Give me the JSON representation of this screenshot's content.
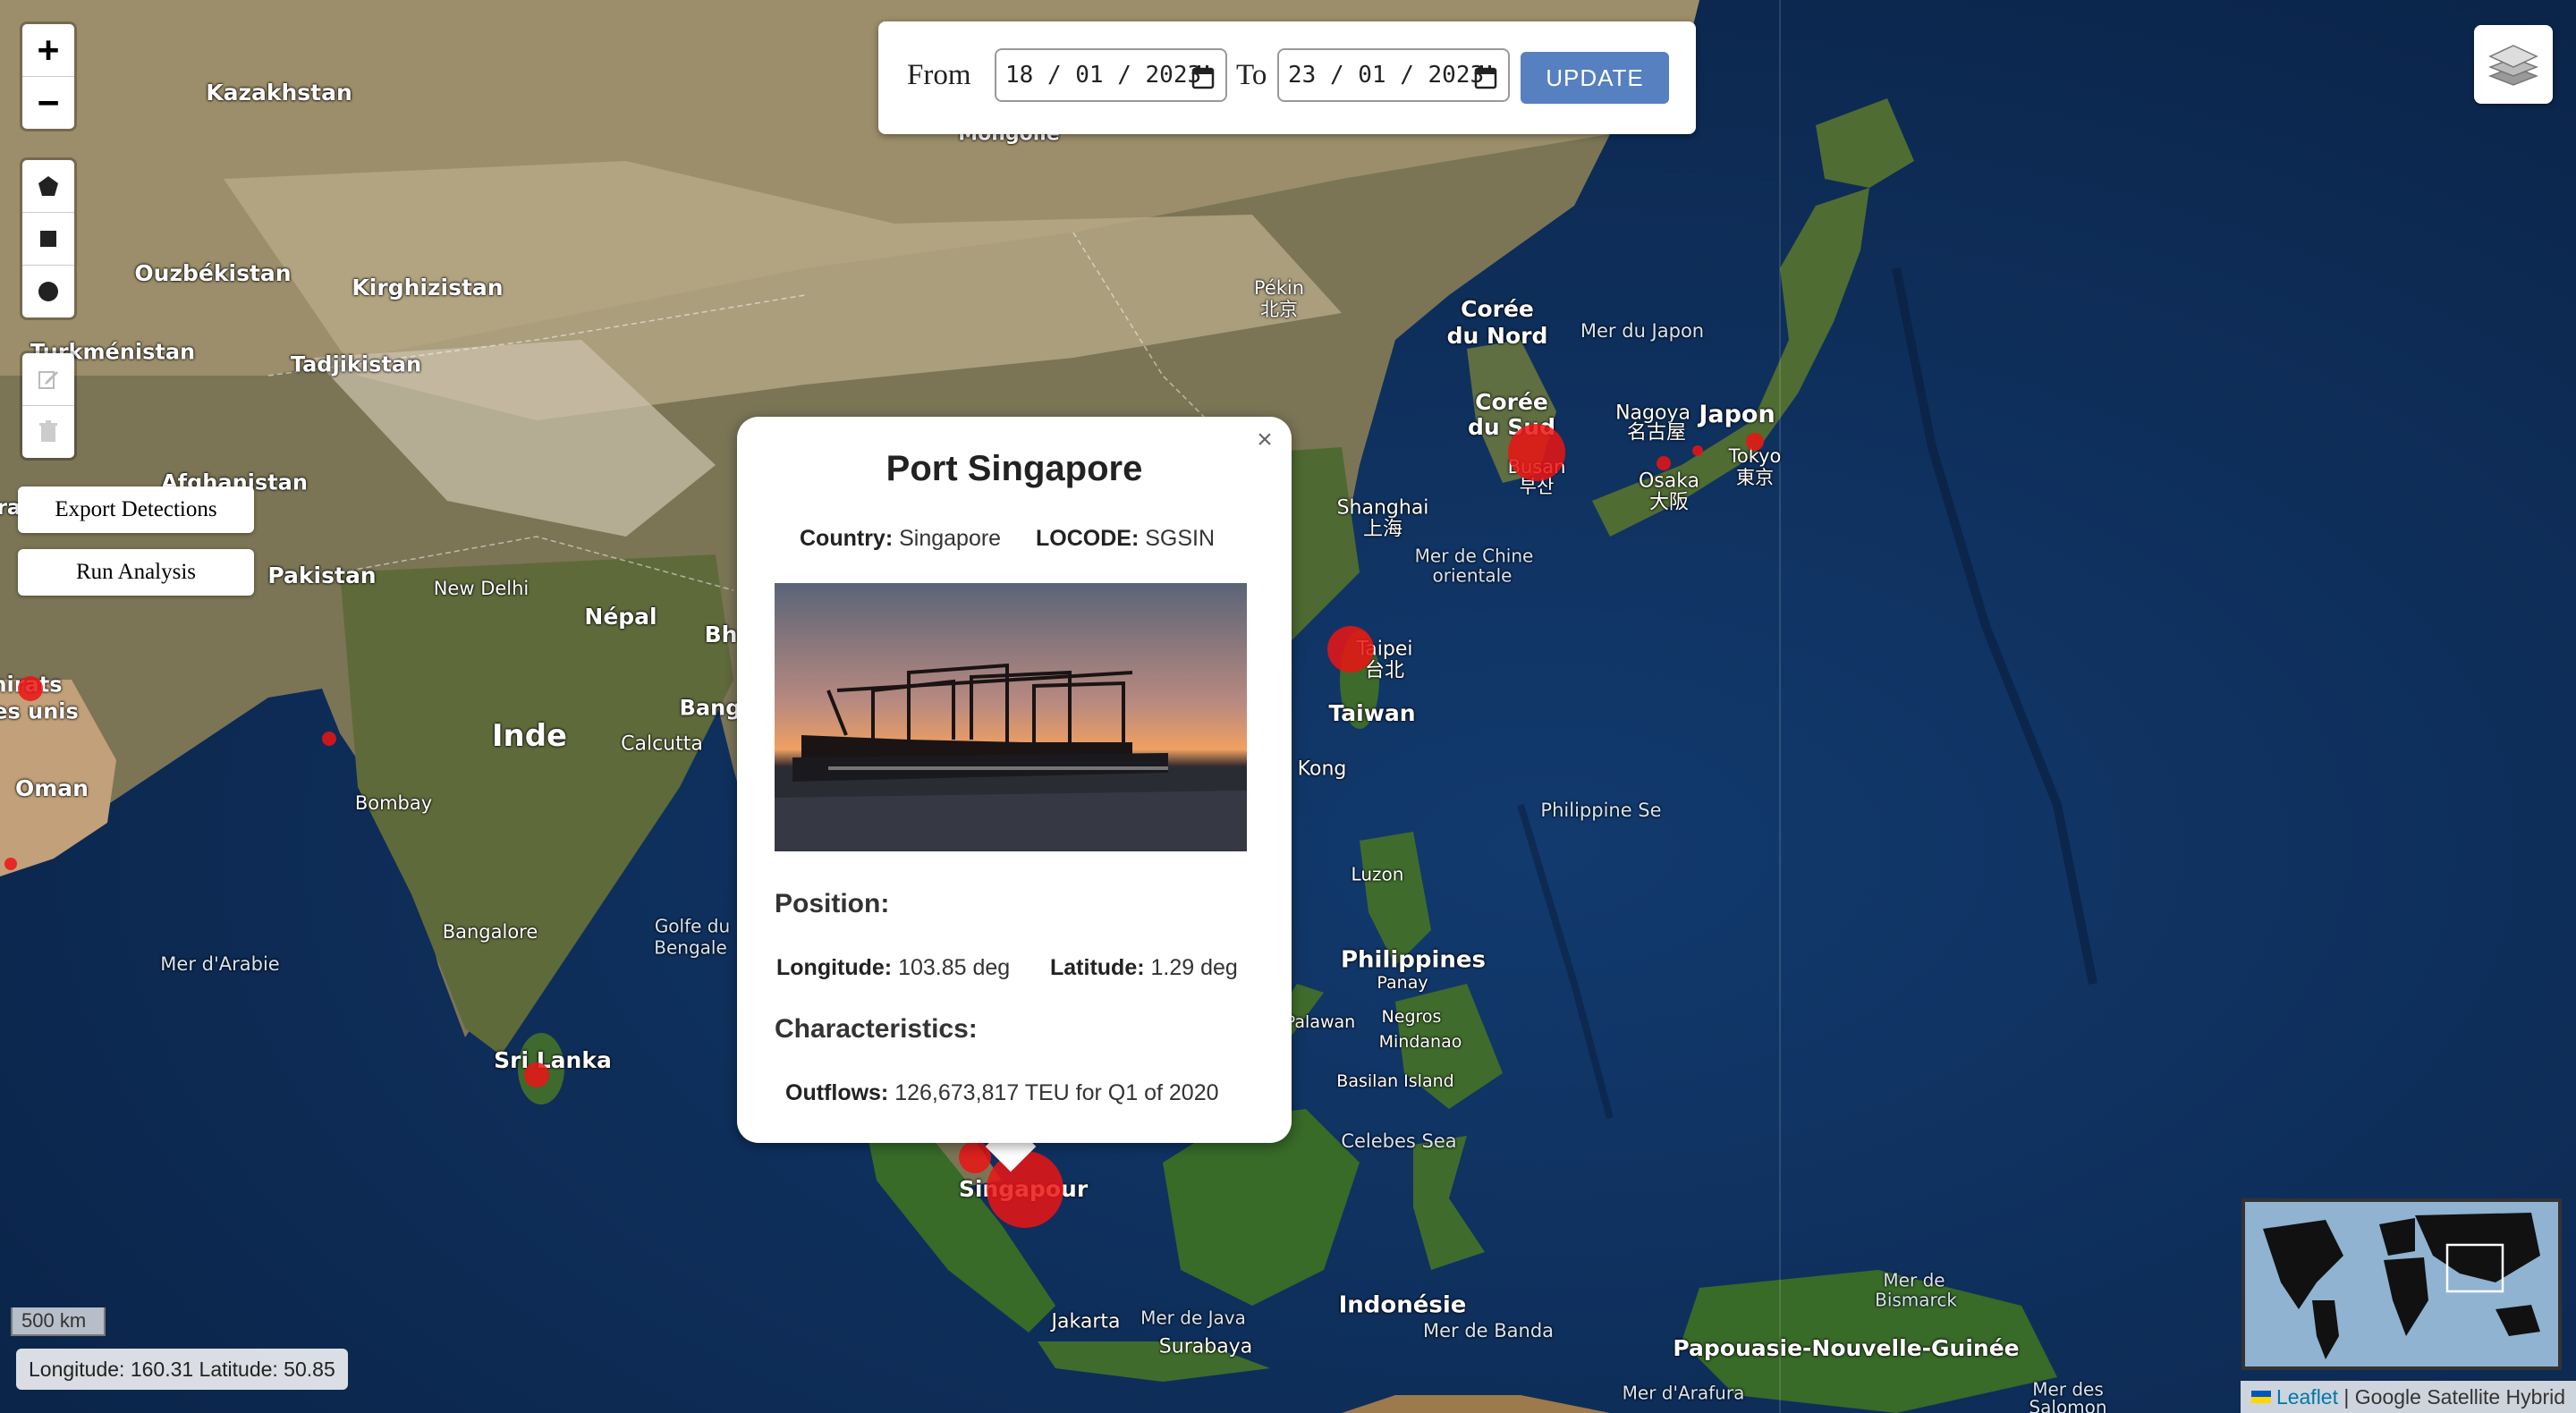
{
  "controls": {
    "zoom_in": "+",
    "zoom_out": "−",
    "draw_tools": [
      "polygon-icon",
      "rectangle-icon",
      "circle-icon",
      "edit-icon",
      "trash-icon"
    ],
    "export_label": "Export Detections",
    "analysis_label": "Run Analysis"
  },
  "datebar": {
    "from_label": "From",
    "from_value": "18 / 01 / 2023",
    "to_label": "To",
    "to_value": "23 / 01 / 2023",
    "update_label": "UPDATE"
  },
  "map_labels": {
    "kazakhstan": "Kazakhstan",
    "mongolie": "Mongolie",
    "ouzbekistan": "Ouzbékistan",
    "kirghizistan": "Kirghizistan",
    "turkmenistan": "Turkménistan",
    "tadjikistan": "Tadjikistan",
    "afghanistan": "Afghanistan",
    "pakistan": "Pakistan",
    "new_delhi": "New Delhi",
    "nepal": "Népal",
    "bh": "Bh",
    "inde": "Inde",
    "calcutta": "Calcutta",
    "bang": "Bang",
    "bombay": "Bombay",
    "oman": "Oman",
    "emirats_1": "nirats",
    "emirats_2": "es unis",
    "ira": "ra",
    "mer_arabie": "Mer d'Arabie",
    "bangalore": "Bangalore",
    "golfe_bengale_1": "Golfe du",
    "golfe_bengale_2": "Bengale",
    "sri_lanka": "Sri Lanka",
    "pekin_1": "Pékin",
    "pekin_2": "北京",
    "coree_nord_1": "Corée",
    "coree_nord_2": "du Nord",
    "mer_japon": "Mer du Japon",
    "coree_sud_1": "Corée",
    "coree_sud_2": "du Sud",
    "busan_1": "Busan",
    "busan_2": "부산",
    "nagoya_1": "Nagoya",
    "nagoya_2": "名古屋",
    "japon": "Japon",
    "tokyo_1": "Tokyo",
    "tokyo_2": "東京",
    "osaka_1": "Osaka",
    "osaka_2": "大阪",
    "shanghai_1": "Shanghai",
    "shanghai_2": "上海",
    "mer_chine_1": "Mer de Chine",
    "mer_chine_2": "orientale",
    "taipei_1": "Taipei",
    "taipei_2": "台北",
    "taiwan": "Taiwan",
    "kong": "Kong",
    "philippine_sea": "Philippine Se",
    "luzon": "Luzon",
    "philippines": "Philippines",
    "panay": "Panay",
    "negros": "Negros",
    "palawan": "Palawan",
    "mindanao": "Mindanao",
    "basilan": "Basilan Island",
    "celebes": "Celebes Sea",
    "singapour": "Singapour",
    "jakarta": "Jakarta",
    "mer_java": "Mer de Java",
    "surabaya": "Surabaya",
    "indonesie": "Indonésie",
    "mer_banda": "Mer de Banda",
    "mer_bismarck_1": "Mer de",
    "mer_bismarck_2": "Bismarck",
    "papouasie": "Papouasie-Nouvelle-Guinée",
    "mer_arafura": "Mer d'Arafura",
    "mer_salomon_1": "Mer des",
    "mer_salomon_2": "Salomon"
  },
  "popup": {
    "title": "Port Singapore",
    "country_label": "Country:",
    "country": "Singapore",
    "locode_label": "LOCODE:",
    "locode": "SGSIN",
    "position_heading": "Position:",
    "longitude_label": "Longitude:",
    "longitude": "103.85 deg",
    "latitude_label": "Latitude:",
    "latitude": "1.29 deg",
    "characteristics_heading": "Characteristics:",
    "outflows_label": "Outflows:",
    "outflows": "126,673,817 TEU for Q1 of 2020",
    "close": "×"
  },
  "scale": "500 km",
  "coords": "Longitude: 160.31 Latitude: 50.85",
  "attribution": {
    "leaflet": "Leaflet",
    "separator": " | ",
    "layer": "Google Satellite Hybrid"
  },
  "colors": {
    "marker": "#eb1414",
    "update_button": "#5680c0",
    "ocean": "#0d2a52"
  },
  "layers_icon": "layers-icon"
}
